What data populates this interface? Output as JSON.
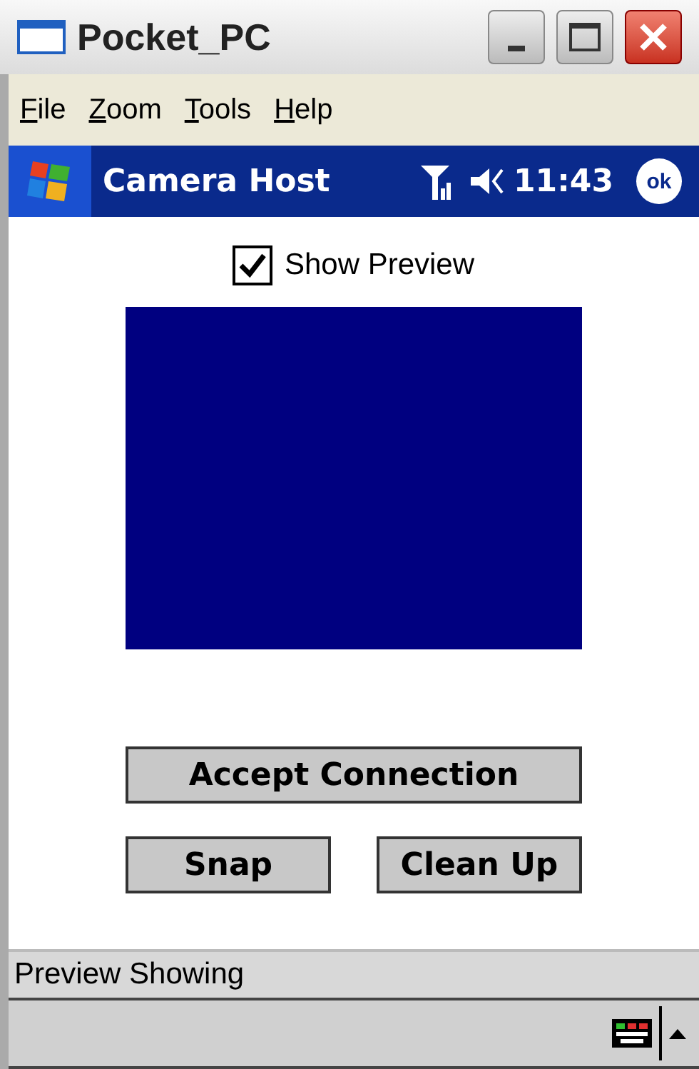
{
  "window": {
    "title": "Pocket_PC"
  },
  "menu": [
    "File",
    "Zoom",
    "Tools",
    "Help"
  ],
  "nav_bar": {
    "title": "Camera Host",
    "time": "11:43",
    "ok": "ok"
  },
  "show_preview": {
    "label": "Show Preview",
    "checked": true
  },
  "buttons": [
    {
      "label": "Accept Connection",
      "kind": "wide"
    },
    {
      "label": "Snap",
      "kind": "half"
    },
    {
      "label": "Clean Up",
      "kind": "half"
    }
  ],
  "status_bar": "Preview Showing"
}
